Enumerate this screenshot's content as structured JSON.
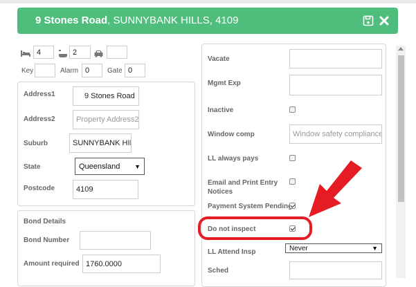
{
  "header": {
    "address_bold": "9 Stones Road",
    "address_rest": ", SUNNYBANK HILLS, 4109",
    "save_icon": "floppy-disk-icon",
    "close_icon": "close-x-icon",
    "bg_color": "#4fbe7c"
  },
  "top_fields": {
    "bedrooms": "4",
    "bathrooms": "2",
    "cars": "",
    "key_label": "Key",
    "key_value": "",
    "alarm_label": "Alarm",
    "alarm_value": "0",
    "gate_label": "Gate",
    "gate_value": "0"
  },
  "address_panel": {
    "address1_label": "Address1",
    "address1_value": "9 Stones Road",
    "address2_label": "Address2",
    "address2_placeholder": "Property Address2",
    "suburb_label": "Suburb",
    "suburb_value": "SUNNYBANK HILLS",
    "state_label": "State",
    "state_value": "Queensland",
    "postcode_label": "Postcode",
    "postcode_value": "4109"
  },
  "bond_panel": {
    "title": "Bond Details",
    "bond_number_label": "Bond Number",
    "bond_number_value": "",
    "amount_label": "Amount required",
    "amount_value": "1760.0000"
  },
  "right_panel": {
    "vacate_label": "Vacate",
    "vacate_value": "",
    "mgmt_exp_label": "Mgmt Exp",
    "mgmt_exp_value": "",
    "inactive_label": "Inactive",
    "inactive_checked": false,
    "window_comp_label": "Window comp",
    "window_comp_placeholder": "Window safety compliance",
    "ll_always_pays_label": "LL always pays",
    "ll_always_pays_checked": false,
    "email_print_label_1": "Email and Print Entry",
    "email_print_label_2": "Notices",
    "email_print_checked": false,
    "payment_system_label": "Payment System Pending",
    "payment_system_checked": true,
    "do_not_inspect_label": "Do not inspect",
    "do_not_inspect_checked": true,
    "ll_attend_label": "LL Attend Insp",
    "ll_attend_value": "Never",
    "sched_label": "Sched",
    "sched_value": ""
  },
  "annotation": {
    "arrow_color": "#e51c23"
  }
}
